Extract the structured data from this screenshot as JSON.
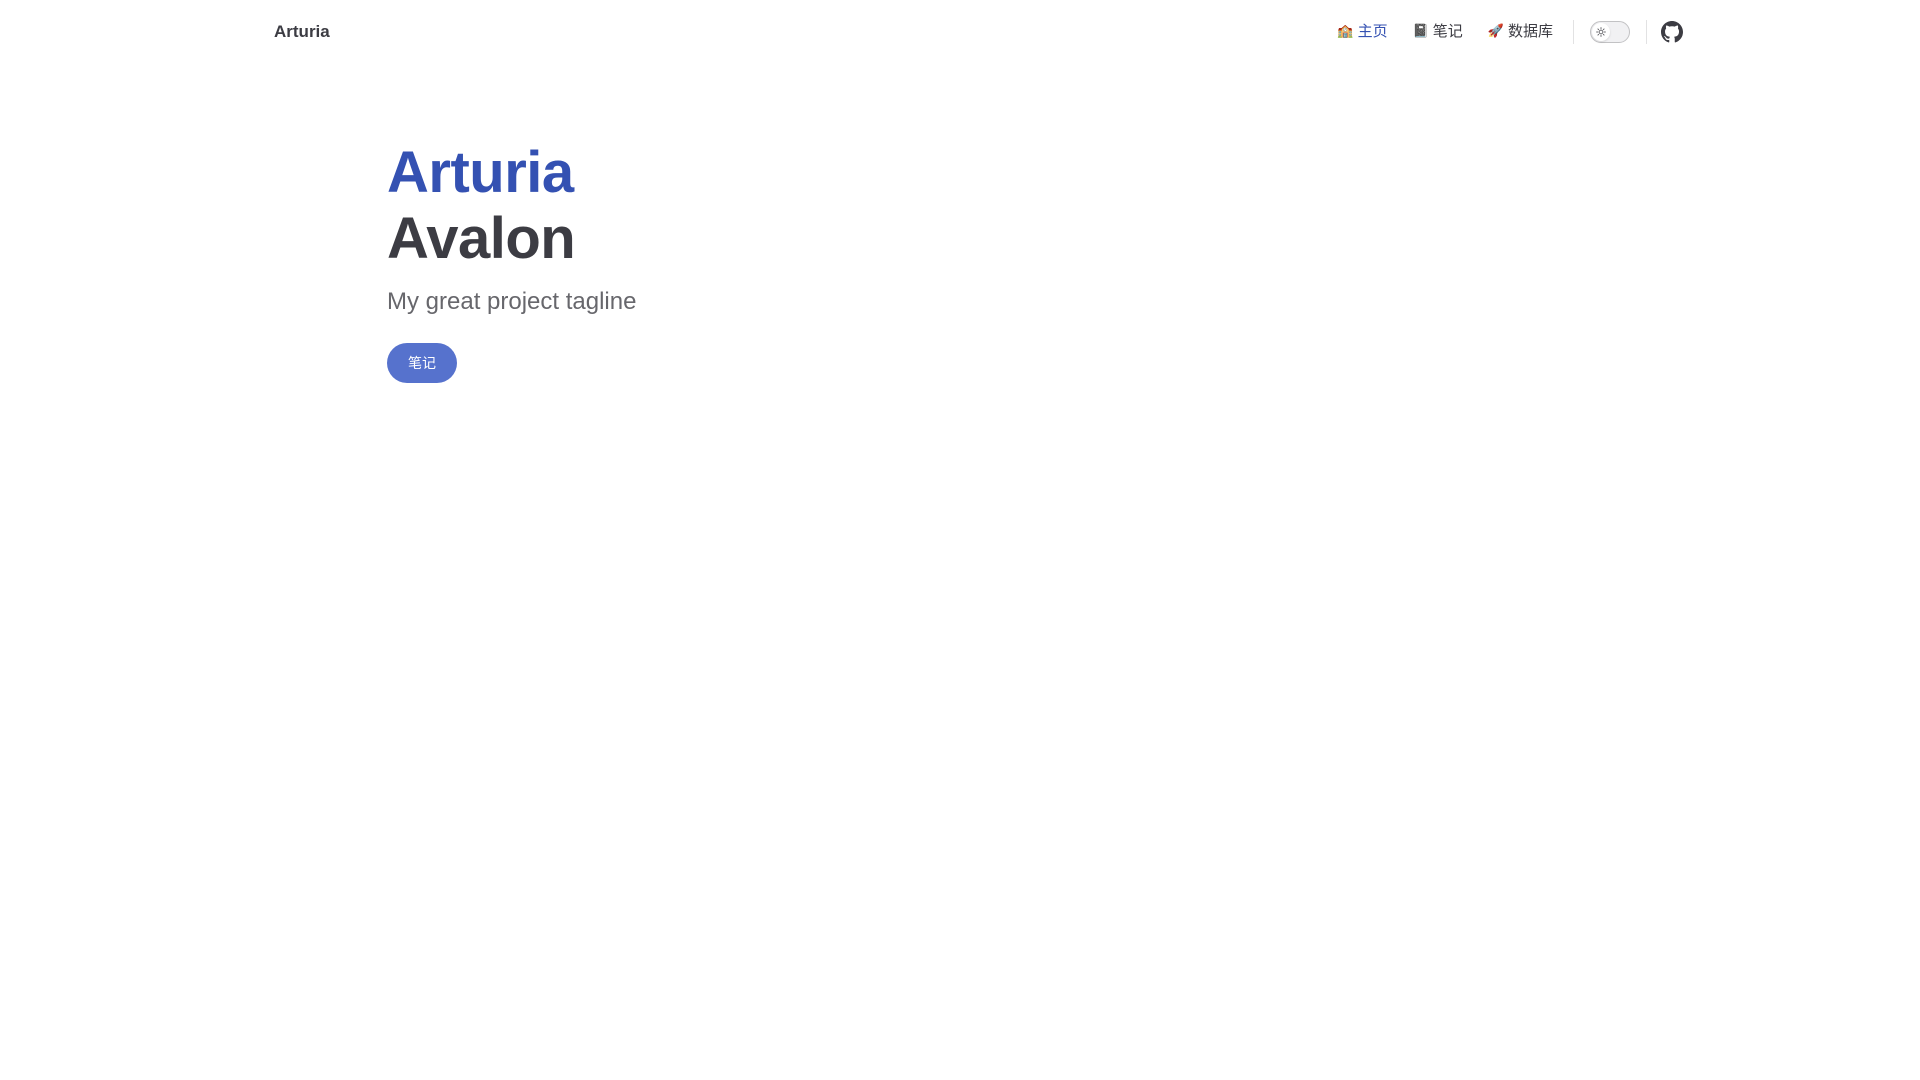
{
  "header": {
    "site_title": "Arturia",
    "nav": [
      {
        "emoji": "🏫",
        "label": "主页",
        "active": true
      },
      {
        "emoji": "📓",
        "label": "笔记",
        "active": false
      },
      {
        "emoji": "🚀",
        "label": "数据库",
        "active": false
      }
    ],
    "appearance_toggle": {
      "icon": "sun-icon",
      "state": "light"
    },
    "social_icon": "github-icon"
  },
  "hero": {
    "name": "Arturia",
    "text": "Avalon",
    "tagline": "My great project tagline",
    "action_label": "笔记"
  },
  "colors": {
    "brand": "#3451b2",
    "button": "#5672cd",
    "text": "#3c3c43",
    "muted": "#67676c"
  }
}
